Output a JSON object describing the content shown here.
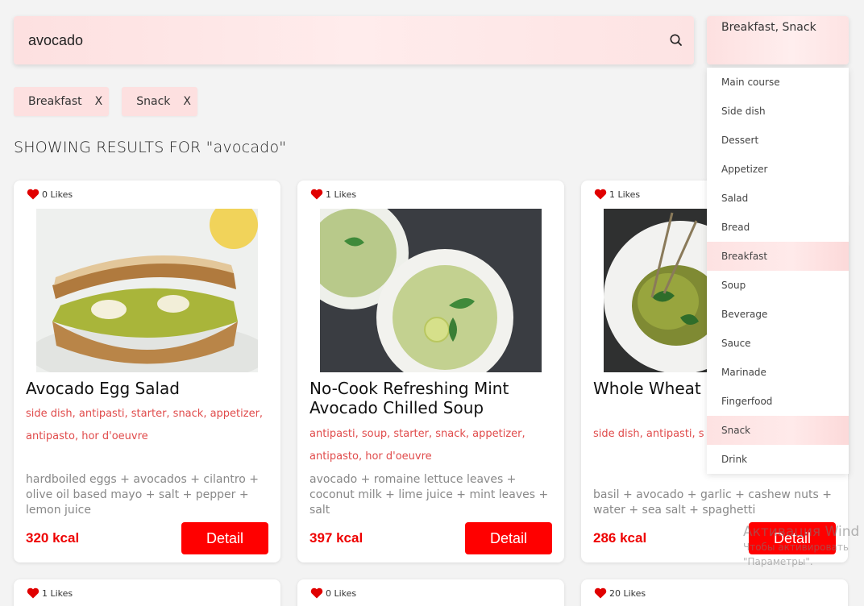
{
  "search": {
    "value": "avocado"
  },
  "category_select": {
    "value": "Breakfast, Snack",
    "options": [
      "Main course",
      "Side dish",
      "Dessert",
      "Appetizer",
      "Salad",
      "Bread",
      "Breakfast",
      "Soup",
      "Beverage",
      "Sauce",
      "Marinade",
      "Fingerfood",
      "Snack",
      "Drink"
    ],
    "selected": [
      "Breakfast",
      "Snack"
    ]
  },
  "filters": [
    {
      "label": "Breakfast",
      "remove": "X"
    },
    {
      "label": "Snack",
      "remove": "X"
    }
  ],
  "results_title": "SHOWING RESULTS FOR \"avocado\"",
  "cards": [
    {
      "likes": "0 Likes",
      "title": "Avocado Egg Salad",
      "tags": "side dish, antipasti, starter, snack, appetizer, antipasto, hor d'oeuvre",
      "ingredients": "hardboiled eggs + avocados + cilantro + olive oil based mayo + salt + pepper + lemon juice",
      "kcal": "320 kcal",
      "button": "Detail"
    },
    {
      "likes": "1 Likes",
      "title": "No-Cook Refreshing Mint Avocado Chilled Soup",
      "tags": "antipasti, soup, starter, snack, appetizer, antipasto, hor d'oeuvre",
      "ingredients": "avocado + romaine lettuce leaves + coconut milk + lime juice + mint leaves + salt",
      "kcal": "397 kcal",
      "button": "Detail"
    },
    {
      "likes": "1 Likes",
      "title": "Whole Wheat Basil Avocado",
      "tags": "side dish, antipasti, s appetizer, antipasto, h",
      "ingredients": "basil + avocado + garlic + cashew nuts + water + sea salt + spaghetti",
      "kcal": "286 kcal",
      "button": "Detail"
    }
  ],
  "more_cards": [
    {
      "likes": "1 Likes"
    },
    {
      "likes": "0 Likes"
    },
    {
      "likes": "20 Likes"
    }
  ],
  "watermark": {
    "line1": "Активация Wind",
    "line2": "Чтобы активировать",
    "line3": "\"Параметры\"."
  },
  "colors": {
    "accent": "#ff0000",
    "tag": "#e04b4b",
    "heart": "#e00000"
  }
}
